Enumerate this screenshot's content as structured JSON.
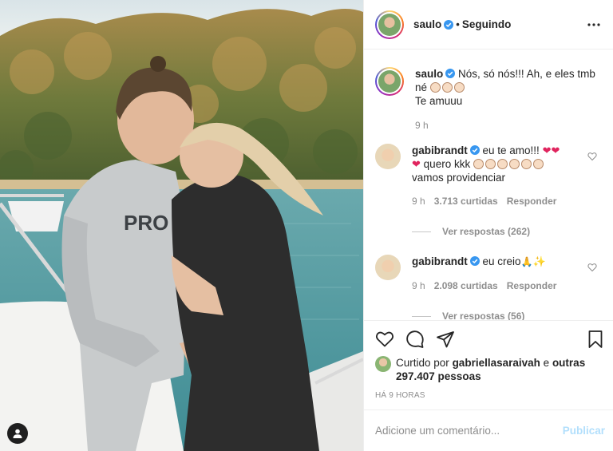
{
  "post": {
    "author": "saulo",
    "follow_status": "Seguindo",
    "separator": "•"
  },
  "caption": {
    "username": "saulo",
    "line1": "Nós, só nós!!! Ah, e eles tmb",
    "line2": "né",
    "line3": "Te amuuu",
    "time": "9 h"
  },
  "comments": [
    {
      "username": "gabibrandt",
      "text_a": "eu te amo!!!",
      "text_b": "quero kkk",
      "text_c": "vamos providenciar",
      "time": "9 h",
      "likes": "3.713 curtidas",
      "reply": "Responder",
      "view_replies": "Ver respostas (262)"
    },
    {
      "username": "gabibrandt",
      "text_a": "eu creio",
      "time": "9 h",
      "likes": "2.098 curtidas",
      "reply": "Responder",
      "view_replies": "Ver respostas (56)"
    }
  ],
  "likes_summary": {
    "prefix": "Curtido por",
    "user": "gabriellasaraivah",
    "and": "e",
    "others": "outras 297.407 pessoas"
  },
  "timestamp": "HÁ 9 HORAS",
  "add_comment": {
    "placeholder": "Adicione um comentário...",
    "publish": "Publicar"
  },
  "icons": {
    "like": "heart-icon",
    "comment": "comment-icon",
    "share": "send-icon",
    "save": "bookmark-icon",
    "more": "more-icon",
    "verified": "verified-icon",
    "tag": "user-tag-icon"
  },
  "colors": {
    "verified": "#3897f0",
    "link_disabled": "#b2dffc",
    "muted": "#8e8e8e"
  }
}
